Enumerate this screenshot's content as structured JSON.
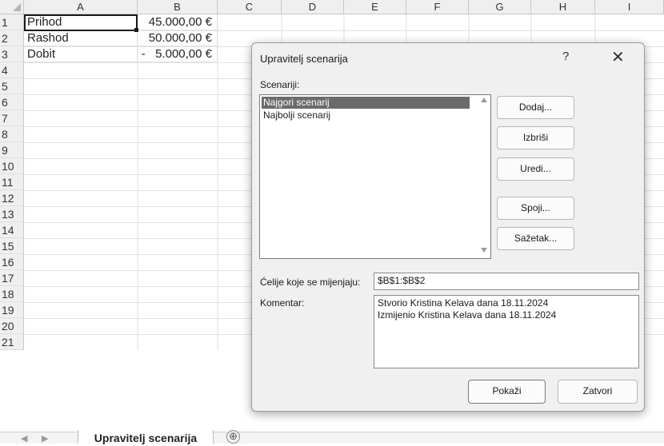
{
  "spreadsheet": {
    "columns": [
      "A",
      "B",
      "C",
      "D",
      "E",
      "F",
      "G",
      "H",
      "I"
    ],
    "rows": [
      "1",
      "2",
      "3",
      "4",
      "5",
      "6",
      "7",
      "8",
      "9",
      "10",
      "11",
      "12",
      "13",
      "14",
      "15",
      "16",
      "17",
      "18",
      "19",
      "20",
      "21"
    ],
    "cells": [
      {
        "label": "Prihod",
        "value": "45.000,00 €"
      },
      {
        "label": "Rashod",
        "value": "50.000,00 €"
      },
      {
        "label": "Dobit",
        "value": "-   5.000,00 €"
      }
    ]
  },
  "sheet_tabs": {
    "active": "Upravitelj scenarija",
    "add_icon": "⊕",
    "nav_prev": "◀",
    "nav_next": "▶"
  },
  "dialog": {
    "title": "Upravitelj scenarija",
    "help": "?",
    "close": "✕",
    "scenarios_label": "Scenariji:",
    "scenarios": [
      "Najgori scenarij",
      "Najbolji scenarij"
    ],
    "selected_index": 0,
    "buttons": {
      "add": "Dodaj...",
      "delete": "Izbriši",
      "edit": "Uredi...",
      "merge": "Spoji...",
      "summary": "Sažetak...",
      "show": "Pokaži",
      "close": "Zatvori"
    },
    "changing_cells_label": "Ćelije koje se mijenjaju:",
    "changing_cells_value": "$B$1:$B$2",
    "comment_label": "Komentar:",
    "comment_lines": [
      "Stvorio Kristina Kelava dana 18.11.2024",
      "Izmijenio Kristina Kelava dana 18.11.2024"
    ]
  }
}
